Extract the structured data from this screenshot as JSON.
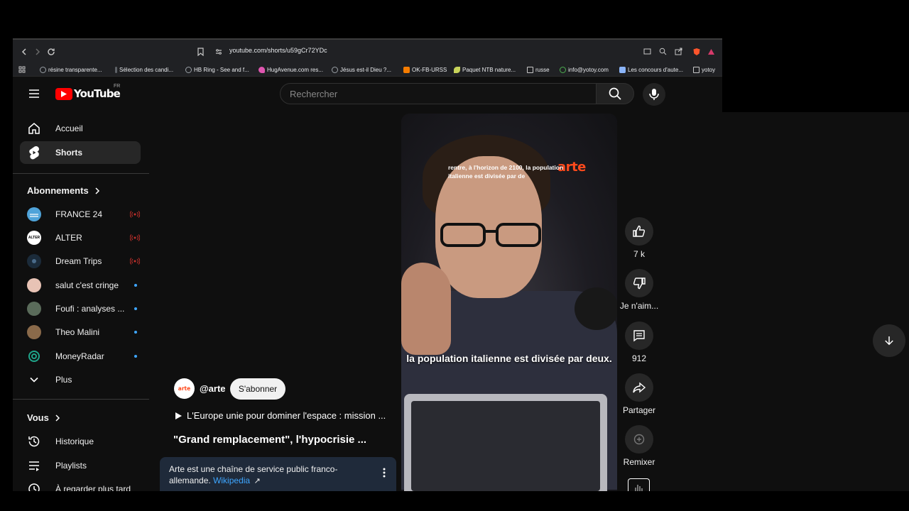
{
  "browser": {
    "url": "youtube.com/shorts/u59gCr72YDc",
    "bookmarks": [
      {
        "label": "résine transparente...",
        "color": "#9aa0a6"
      },
      {
        "label": "Sélection des candi...",
        "color": "#5f6368"
      },
      {
        "label": "HB Ring - See and f...",
        "color": "#9aa0a6"
      },
      {
        "label": "HugAvenue.com res...",
        "color": "#e056b0"
      },
      {
        "label": "Jésus est-il Dieu ?...",
        "color": "#9aa0a6"
      },
      {
        "label": "OK-FB-URSS",
        "color": "#f57c00"
      },
      {
        "label": "Paquet NTB nature...",
        "color": "#c7d35a"
      },
      {
        "label": "russe",
        "color": "#9aa0a6"
      },
      {
        "label": "info@yotoy.com",
        "color": "#4caf50"
      },
      {
        "label": "Les concours d'aute...",
        "color": "#8ab4f8"
      },
      {
        "label": "yotoy",
        "color": "#9aa0a6"
      }
    ]
  },
  "header": {
    "logo_text": "YouTube",
    "region": "FR",
    "search_placeholder": "Rechercher"
  },
  "sidebar": {
    "main": [
      {
        "label": "Accueil",
        "icon": "home-icon"
      },
      {
        "label": "Shorts",
        "icon": "shorts-icon",
        "active": true
      }
    ],
    "subscriptions_title": "Abonnements",
    "subscriptions": [
      {
        "label": "FRANCE 24",
        "status": "live",
        "avatar_color": "#4fa3d9"
      },
      {
        "label": "ALTER",
        "status": "live",
        "avatar_color": "#ffffff"
      },
      {
        "label": "Dream Trips",
        "status": "live",
        "avatar_color": "#1b2b3a"
      },
      {
        "label": "salut c'est cringe",
        "status": "new",
        "avatar_color": "#e8c3b5"
      },
      {
        "label": "Foufi : analyses ...",
        "status": "new",
        "avatar_color": "#5a6b5a"
      },
      {
        "label": "Theo Malini",
        "status": "new",
        "avatar_color": "#8a6a4a"
      },
      {
        "label": "MoneyRadar",
        "status": "new",
        "avatar_color": "#1fa58a"
      }
    ],
    "more_label": "Plus",
    "you_title": "Vous",
    "you_items": [
      {
        "label": "Historique",
        "icon": "history-icon"
      },
      {
        "label": "Playlists",
        "icon": "playlists-icon"
      },
      {
        "label": "À regarder plus tard",
        "icon": "watch-later-icon"
      }
    ]
  },
  "short": {
    "overlay_logo": "arte",
    "caption_small": "rentre, à l'horizon de 2100, la population italienne est divisée par de",
    "caption_big": "la population italienne est divisée par deux.",
    "channel_handle": "@arte",
    "channel_avatar_text": "arte",
    "subscribe_label": "S'abonner",
    "playlist_line": "L'Europe unie pour dominer l'espace : mission ...",
    "title": "\"Grand remplacement\", l'hypocrisie ...",
    "info_text": "Arte est une chaîne de service public franco-allemande.",
    "info_link": "Wikipedia",
    "info_link_arrow": "↗"
  },
  "actions": {
    "likes": "7 k",
    "dislike_label": "Je n'aim...",
    "comments": "912",
    "share_label": "Partager",
    "remix_label": "Remixer"
  },
  "colors": {
    "brand_red": "#ff0000",
    "arte_orange": "#ff4a1c",
    "link_blue": "#3ea6ff",
    "live_red": "#c4302b"
  }
}
